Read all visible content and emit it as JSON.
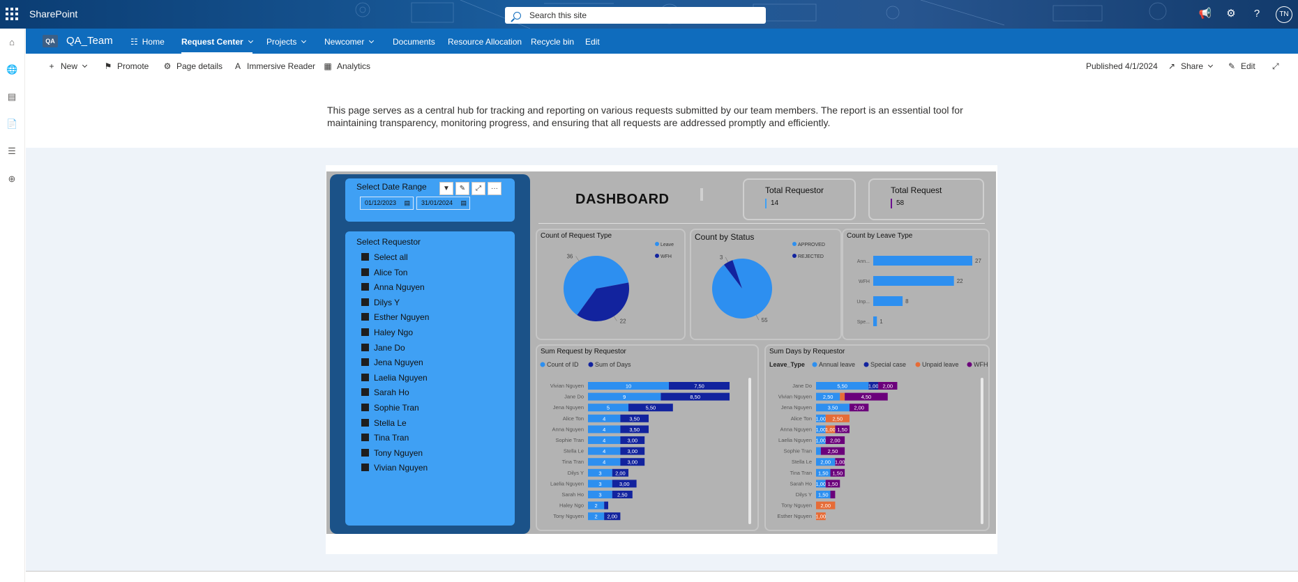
{
  "suite": {
    "app_name": "SharePoint",
    "search_placeholder": "Search this site",
    "avatar_initials": "TN"
  },
  "site": {
    "logo": "QA",
    "name": "QA_Team",
    "nav": [
      {
        "label": "Home",
        "icon": "home-sites-icon"
      },
      {
        "label": "Request Center",
        "active": true,
        "dropdown": true
      },
      {
        "label": "Projects",
        "dropdown": true
      },
      {
        "label": "Newcomer",
        "dropdown": true
      },
      {
        "label": "Documents"
      },
      {
        "label": "Resource Allocation"
      },
      {
        "label": "Recycle bin"
      },
      {
        "label": "Edit"
      }
    ]
  },
  "commands": {
    "new": "New",
    "promote": "Promote",
    "page_details": "Page details",
    "immersive_reader": "Immersive Reader",
    "analytics": "Analytics",
    "published": "Published 4/1/2024",
    "share": "Share",
    "edit": "Edit"
  },
  "intro_text": "This page serves as a central hub for tracking and reporting on various requests submitted by our team members. The report is an essential tool for maintaining transparency, monitoring progress, and ensuring that all requests are addressed promptly and efficiently.",
  "report": {
    "date_slicer": {
      "title": "Select Date Range",
      "from": "01/12/2023",
      "to": "31/01/2024"
    },
    "requestor_slicer": {
      "title": "Select Requestor",
      "items": [
        "Select all",
        "Alice Ton",
        "Anna Nguyen",
        "Dilys Y",
        "Esther Nguyen",
        "Haley Ngo",
        "Jane Do",
        "Jena Nguyen",
        "Laelia Nguyen",
        "Sarah Ho",
        "Sophie Tran",
        "Stella Le",
        "Tina Tran",
        "Tony Nguyen",
        "Vivian Nguyen"
      ]
    },
    "dashboard_title": "DASHBOARD",
    "cards": [
      {
        "title": "Total Requestor",
        "value": "14",
        "accent": "#3fa0f4"
      },
      {
        "title": "Total Request",
        "value": "58",
        "accent": "#6b0f8f"
      }
    ],
    "colors": {
      "light_blue": "#2d8ff0",
      "dark_blue": "#12239e",
      "orange": "#e66c37",
      "purple": "#6b007b"
    }
  },
  "chart_data": [
    {
      "type": "pie",
      "title": "Count of Request Type",
      "legend": [
        "Leave",
        "WFH"
      ],
      "legend_position": "top-right",
      "slices": [
        {
          "name": "Leave",
          "value": 36,
          "color": "#2d8ff0"
        },
        {
          "name": "WFH",
          "value": 22,
          "color": "#12239e"
        }
      ]
    },
    {
      "type": "pie",
      "title": "Count by Status",
      "legend": [
        "APPROVED",
        "REJECTED"
      ],
      "legend_position": "top-right",
      "slices": [
        {
          "name": "APPROVED",
          "value": 55,
          "color": "#2d8ff0"
        },
        {
          "name": "REJECTED",
          "value": 3,
          "color": "#12239e"
        }
      ]
    },
    {
      "type": "bar",
      "orientation": "horizontal",
      "title": "Count by Leave Type",
      "categories": [
        "Ann...",
        "WFH",
        "Unp...",
        "Spe..."
      ],
      "values": [
        27,
        22,
        8,
        1
      ],
      "color": "#2d8ff0"
    },
    {
      "type": "bar",
      "orientation": "horizontal",
      "stacked": true,
      "title": "Sum Request by Requestor",
      "legend_position": "top-left",
      "categories": [
        "Vivian Nguyen",
        "Jane Do",
        "Jena Nguyen",
        "Alice Ton",
        "Anna Nguyen",
        "Sophie Tran",
        "Stella Le",
        "Tina Tran",
        "Dilys Y",
        "Laelia Nguyen",
        "Sarah Ho",
        "Haley Ngo",
        "Tony Nguyen"
      ],
      "series": [
        {
          "name": "Count of ID",
          "color": "#2d8ff0",
          "values": [
            10,
            9,
            5,
            4,
            4,
            4,
            4,
            4,
            3,
            3,
            3,
            2,
            2
          ],
          "labels": [
            "10",
            "9",
            "5",
            "4",
            "4",
            "4",
            "4",
            "4",
            "3",
            "3",
            "3",
            "2",
            "2"
          ]
        },
        {
          "name": "Sum of Days",
          "color": "#12239e",
          "values": [
            7.5,
            8.5,
            5.5,
            3.5,
            3.5,
            3.0,
            3.0,
            3.0,
            2.0,
            3.0,
            2.5,
            0.5,
            2.0
          ],
          "labels": [
            "7,50",
            "8,50",
            "5,50",
            "3,50",
            "3,50",
            "3,00",
            "3,00",
            "3,00",
            "2,00",
            "3,00",
            "2,50",
            "",
            "2,00"
          ]
        }
      ]
    },
    {
      "type": "bar",
      "orientation": "horizontal",
      "stacked": true,
      "title": "Sum Days by Requestor",
      "legend_title": "Leave_Type",
      "legend_position": "top-left",
      "categories": [
        "Jane Do",
        "Vivian Nguyen",
        "Jena Nguyen",
        "Alice Ton",
        "Anna Nguyen",
        "Laelia Nguyen",
        "Sophie Tran",
        "Stella Le",
        "Tina Tran",
        "Sarah Ho",
        "Dilys Y",
        "Tony Nguyen",
        "Esther Nguyen"
      ],
      "series": [
        {
          "name": "Annual leave",
          "color": "#2d8ff0",
          "values": [
            5.5,
            2.5,
            3.5,
            1.0,
            1.0,
            1.0,
            0.5,
            2.0,
            1.5,
            1.0,
            1.5,
            0,
            0
          ],
          "labels": [
            "5,50",
            "2,50",
            "3,50",
            "1,00",
            "1,00",
            "1,00",
            "",
            "2,00",
            "1,50",
            "1,00",
            "1,50",
            "",
            ""
          ]
        },
        {
          "name": "Special case",
          "color": "#12239e",
          "values": [
            1.0,
            0,
            0,
            0,
            0,
            0,
            0,
            0,
            0,
            0,
            0,
            0,
            0
          ],
          "labels": [
            "1,00",
            "",
            "",
            "",
            "",
            "",
            "",
            "",
            "",
            "",
            "",
            "",
            ""
          ]
        },
        {
          "name": "Unpaid leave",
          "color": "#e66c37",
          "values": [
            0,
            0.5,
            0,
            2.5,
            1.0,
            0,
            0,
            0,
            0,
            0,
            0,
            2.0,
            1.0
          ],
          "labels": [
            "",
            "",
            "",
            "2,50",
            "1,00",
            "",
            "",
            "",
            "",
            "",
            "",
            "2,00",
            "1,00"
          ]
        },
        {
          "name": "WFH",
          "color": "#6b007b",
          "values": [
            2.0,
            4.5,
            2.0,
            0,
            1.5,
            2.0,
            2.5,
            1.0,
            1.5,
            1.5,
            0.5,
            0,
            0
          ],
          "labels": [
            "2,00",
            "4,50",
            "2,00",
            "",
            "1,50",
            "2,00",
            "2,50",
            "1,00",
            "1,50",
            "1,50",
            "",
            "",
            ""
          ]
        }
      ]
    }
  ]
}
